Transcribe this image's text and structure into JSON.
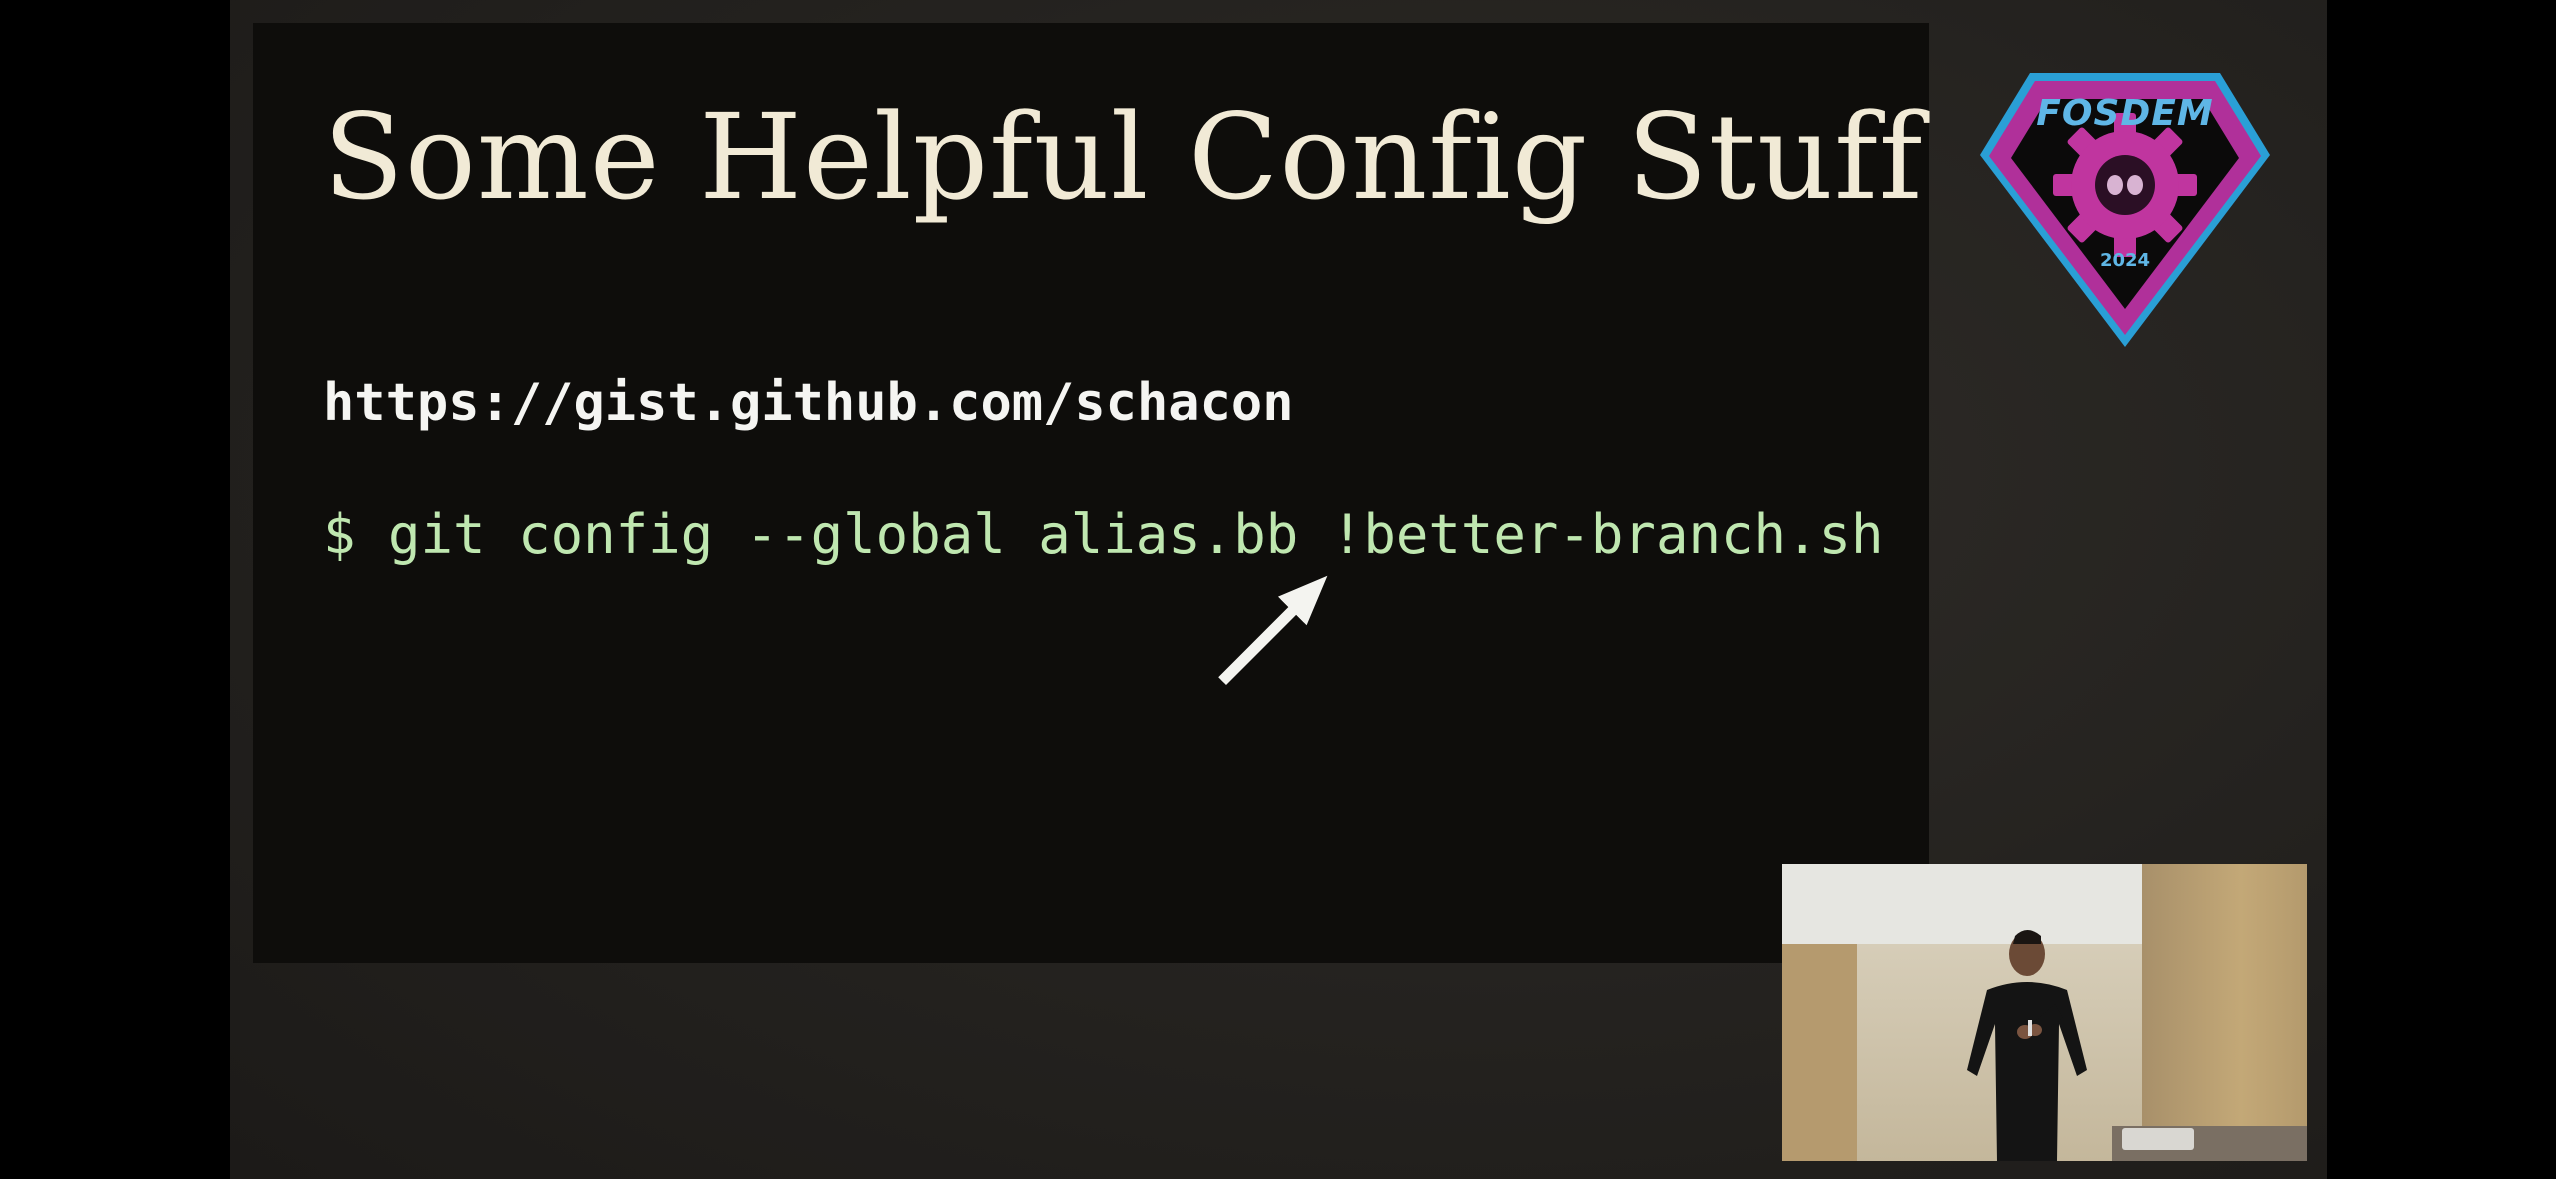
{
  "slide": {
    "title": "Some Helpful Config Stuff",
    "url": "https://gist.github.com/schacon",
    "command": "$ git config --global alias.bb !better-branch.sh"
  },
  "logo": {
    "name": "FOSDEM",
    "year": "2024"
  },
  "colors": {
    "slide_background": "#0e0d0b",
    "title_text": "#f1ead6",
    "command_text": "#bfe7b0",
    "logo_magenta": "#b0309a",
    "logo_blue": "#5fb6e6"
  },
  "icons": {
    "pointer": "arrow-up-right-icon",
    "logo_emblem": "gear-icon"
  }
}
